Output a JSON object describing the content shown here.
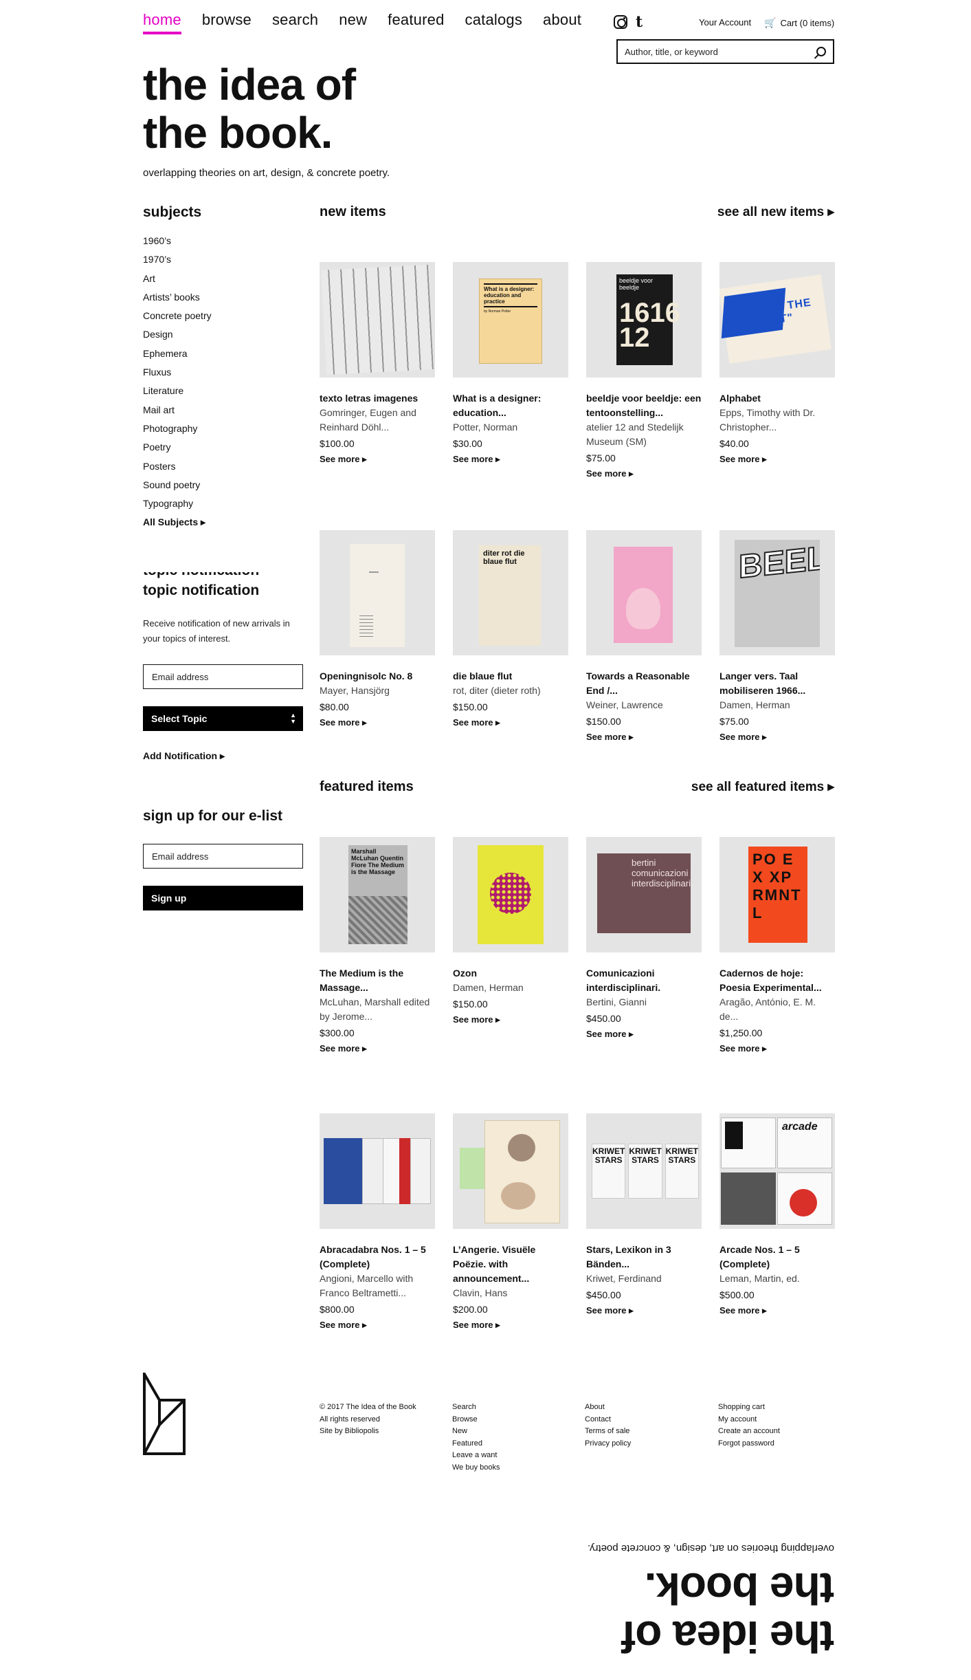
{
  "nav": {
    "home": "home",
    "browse": "browse",
    "search": "search",
    "new": "new",
    "featured": "featured",
    "catalogs": "catalogs",
    "about": "about"
  },
  "header": {
    "account": "Your Account",
    "cart": "Cart (0 items)",
    "search_placeholder": "Author, title, or keyword",
    "logo_line1": "the idea of",
    "logo_line2": "the book.",
    "tagline": "overlapping theories on art, design, & concrete poetry."
  },
  "sidebar": {
    "subjects_heading": "subjects",
    "subjects": [
      "1960’s",
      "1970’s",
      "Art",
      "Artists’ books",
      "Concrete poetry",
      "Design",
      "Ephemera",
      "Fluxus",
      "Literature",
      "Mail art",
      "Photography",
      "Poetry",
      "Posters",
      "Sound poetry",
      "Typography",
      "All Subjects ▸"
    ],
    "topic_heading": "topic notification",
    "topic_text": "Receive notification of new arrivals in your topics of interest.",
    "email_placeholder": "Email address",
    "select_topic": "Select Topic",
    "add_notification": "Add Notification ▸",
    "elist_heading": "sign up for our e-list",
    "signup": "Sign up"
  },
  "new_items": {
    "heading": "new items",
    "see_all": "see all new items ▸",
    "items": [
      {
        "title": "texto letras imagenes",
        "author": "Gomringer, Eugen and Reinhard Döhl...",
        "price": "$100.00",
        "more": "See more ▸"
      },
      {
        "title": "What is a designer: education...",
        "author": "Potter, Norman",
        "price": "$30.00",
        "more": "See more ▸"
      },
      {
        "title": "beeldje voor beeldje: een tentoonstelling...",
        "author": "atelier 12 and Stedelijk Museum (SM)",
        "price": "$75.00",
        "more": "See more ▸"
      },
      {
        "title": "Alphabet",
        "author": "Epps, Timothy with Dr. Christopher...",
        "price": "$40.00",
        "more": "See more ▸"
      },
      {
        "title": "Openingnisolc No. 8",
        "author": "Mayer, Hansjörg",
        "price": "$80.00",
        "more": "See more ▸"
      },
      {
        "title": "die blaue flut",
        "author": "rot, diter (dieter roth)",
        "price": "$150.00",
        "more": "See more ▸"
      },
      {
        "title": "Towards a Reasonable End /...",
        "author": "Weiner, Lawrence",
        "price": "$150.00",
        "more": "See more ▸"
      },
      {
        "title": "Langer vers. Taal mobiliseren 1966...",
        "author": "Damen, Herman",
        "price": "$75.00",
        "more": "See more ▸"
      }
    ]
  },
  "featured_items": {
    "heading": "featured items",
    "see_all": "see all featured items ▸",
    "items": [
      {
        "title": "The Medium is the Massage...",
        "author": "McLuhan, Marshall edited by Jerome...",
        "price": "$300.00",
        "more": "See more ▸"
      },
      {
        "title": "Ozon",
        "author": "Damen, Herman",
        "price": "$150.00",
        "more": "See more ▸"
      },
      {
        "title": "Comunicazioni interdisciplinari.",
        "author": "Bertini, Gianni",
        "price": "$450.00",
        "more": "See more ▸"
      },
      {
        "title": "Cadernos de hoje: Poesia Experimental...",
        "author": "Aragão, António, E. M. de...",
        "price": "$1,250.00",
        "more": "See more ▸"
      },
      {
        "title": "Abracadabra Nos. 1 – 5 (Complete)",
        "author": "Angioni, Marcello with Franco Beltrametti...",
        "price": "$800.00",
        "more": "See more ▸"
      },
      {
        "title": "L’Angerie. Visuële Poëzie. with announcement...",
        "author": "Clavin, Hans",
        "price": "$200.00",
        "more": "See more ▸"
      },
      {
        "title": "Stars, Lexikon in 3 Bänden...",
        "author": "Kriwet, Ferdinand",
        "price": "$450.00",
        "more": "See more ▸"
      },
      {
        "title": "Arcade Nos. 1 – 5 (Complete)",
        "author": "Leman, Martin, ed.",
        "price": "$500.00",
        "more": "See more ▸"
      }
    ]
  },
  "covers": {
    "designer_title": "What is a designer: education and practice",
    "designer_author": "by Norman Potter",
    "beeldje": "beeldje voor beeldje",
    "alphabet": "\"ES THE CAT\"",
    "dieblaue": "diter rot die blaue flut",
    "langer": "BEELD",
    "mcluhan": "Marshall McLuhan Quentin Fiore The Medium is the Massage",
    "bertini": "bertini comunicazioni interdisciplinari.",
    "cadernos": "PO EX XPRMNTL",
    "kriwet": "KRIWET STARS",
    "arcade": "arcade"
  },
  "footer": {
    "col1": [
      "© 2017 The Idea of the Book",
      "All rights reserved",
      "Site by Bibliopolis"
    ],
    "col2": [
      "Search",
      "Browse",
      "New",
      "Featured",
      "Leave a want",
      "We buy books"
    ],
    "col3": [
      "About",
      "Contact",
      "Terms of sale",
      "Privacy policy"
    ],
    "col4": [
      "Shopping cart",
      "My account",
      "Create an account",
      "Forgot password"
    ]
  },
  "colors": {
    "accent": "#e400c3",
    "text": "#111111",
    "thumb_bg": "#e4e4e4"
  }
}
